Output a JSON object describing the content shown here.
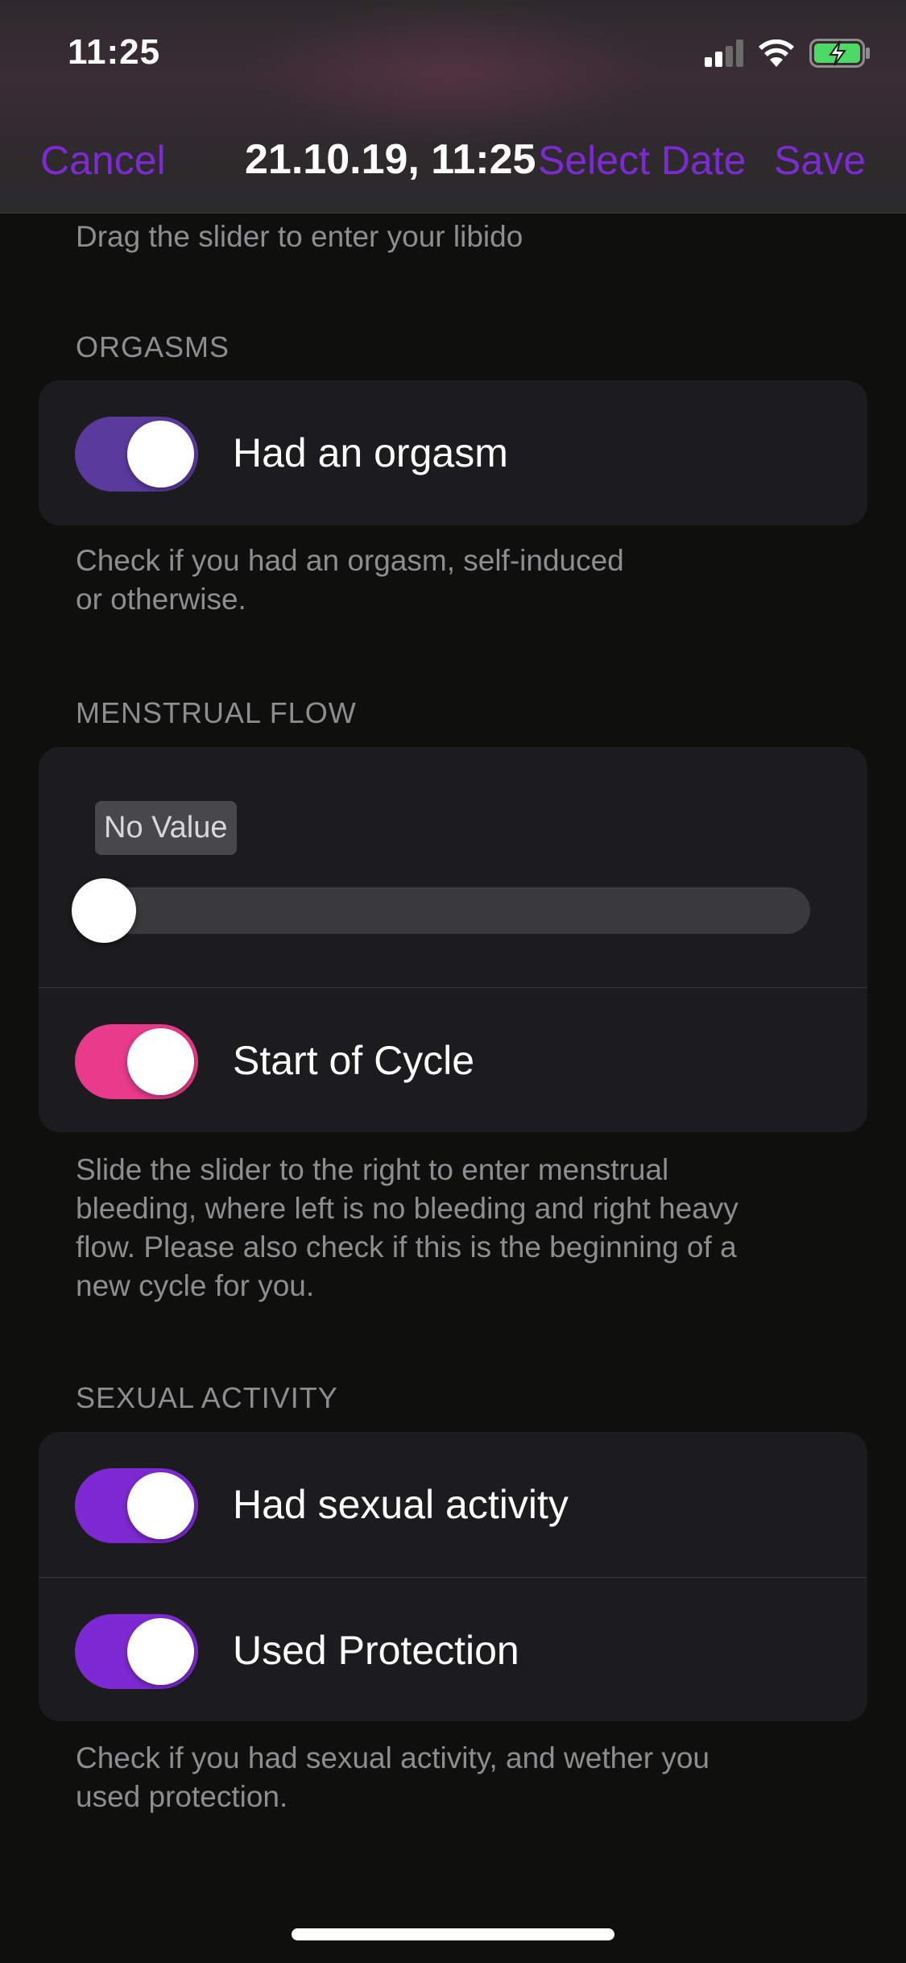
{
  "status_bar": {
    "time": "11:25",
    "icons": [
      "cellular-signal-icon",
      "wifi-icon",
      "battery-charging-icon"
    ]
  },
  "nav": {
    "cancel_label": "Cancel",
    "title": "21.10.19, 11:25",
    "select_date_label": "Select Date",
    "save_label": "Save"
  },
  "libido": {
    "footnote": "Drag the slider to enter your libido"
  },
  "orgasms": {
    "header": "ORGASMS",
    "toggle_label": "Had an orgasm",
    "toggle_on": true,
    "footnote_line1": "Check if you had an orgasm, self-induced",
    "footnote_line2": "or otherwise."
  },
  "menstrual_flow": {
    "header": "MENSTRUAL FLOW",
    "slider_value_label": "No Value",
    "slider_value": 0,
    "start_of_cycle_label": "Start of Cycle",
    "start_of_cycle_on": true,
    "footnote_line1": "Slide the slider to the right to enter menstrual",
    "footnote_line2": "bleeding, where left is no bleeding and right heavy",
    "footnote_line3": "flow. Please also check if this is the beginning of a",
    "footnote_line4": "new cycle for you."
  },
  "sexual_activity": {
    "header": "SEXUAL ACTIVITY",
    "had_activity_label": "Had sexual activity",
    "had_activity_on": true,
    "used_protection_label": "Used Protection",
    "used_protection_on": true,
    "footnote_line1": "Check if you had sexual activity, and wether you",
    "footnote_line2": "used protection."
  },
  "colors": {
    "accent": "#7e2ad4",
    "orgasm_toggle": "#5b3a9e",
    "cycle_toggle": "#e93a8c",
    "activity_toggle": "#7e2ad4"
  }
}
